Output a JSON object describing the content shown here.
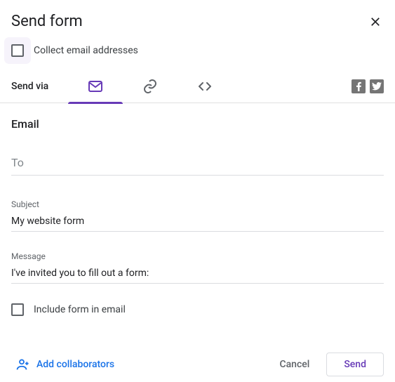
{
  "dialog": {
    "title": "Send form"
  },
  "collect": {
    "label": "Collect email addresses",
    "checked": false
  },
  "send_via": {
    "label": "Send via",
    "active_tab": "email"
  },
  "email_section": {
    "title": "Email",
    "to_placeholder": "To",
    "to_value": "",
    "subject_label": "Subject",
    "subject_value": "My website form",
    "message_label": "Message",
    "message_value": "I've invited you to fill out a form:"
  },
  "include": {
    "label": "Include form in email",
    "checked": false
  },
  "footer": {
    "add_collaborators": "Add collaborators",
    "cancel": "Cancel",
    "send": "Send"
  }
}
